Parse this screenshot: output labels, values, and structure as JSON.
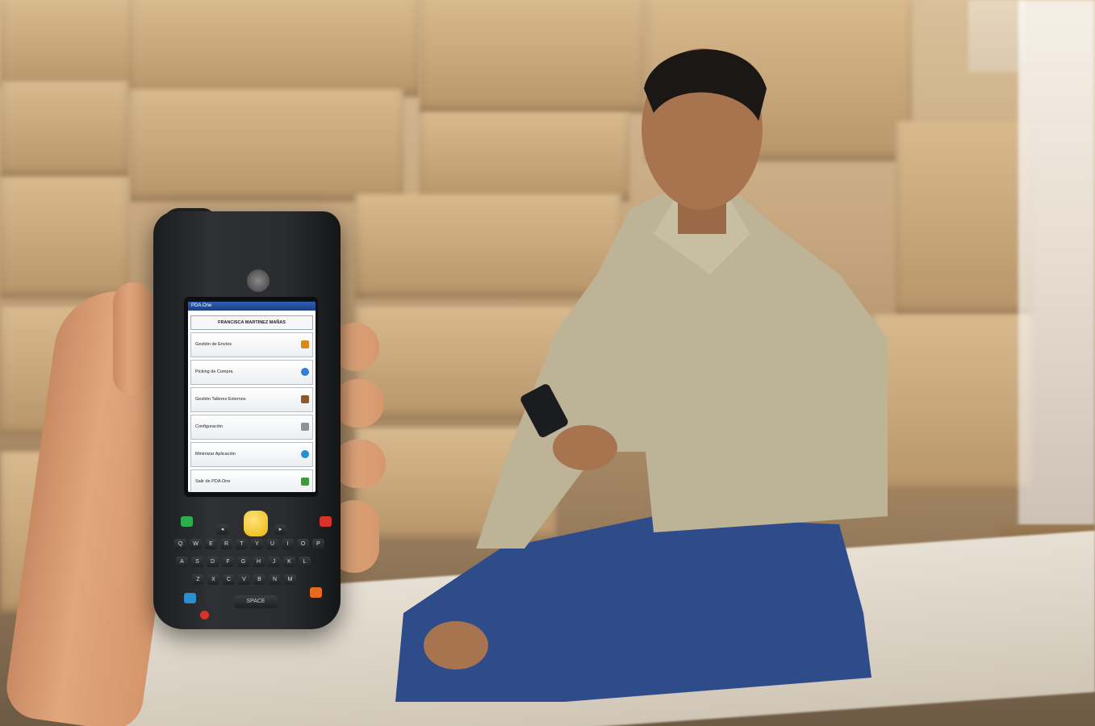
{
  "device": {
    "app_title": "PDA.One",
    "user_name": "FRANCISCA MARTINEZ MAÑAS",
    "menu": [
      {
        "label": "Gestión de Envíos",
        "icon": "truck-icon",
        "color": "#d98a1c"
      },
      {
        "label": "Picking de Compra",
        "icon": "info-icon",
        "color": "#2f7fd6"
      },
      {
        "label": "Gestión Talleres Externos",
        "icon": "workshop-icon",
        "color": "#8a5a2a"
      },
      {
        "label": "Configuración",
        "icon": "wrench-icon",
        "color": "#8f9398"
      },
      {
        "label": "Minimizar Aplicación",
        "icon": "globe-icon",
        "color": "#2a8fd0"
      },
      {
        "label": "Salir de PDA.One",
        "icon": "exit-icon",
        "color": "#3f9a3f"
      }
    ],
    "space_key": "SPACE",
    "keys_row1": [
      "Q",
      "W",
      "E",
      "R",
      "T",
      "Y",
      "U",
      "I",
      "O",
      "P"
    ],
    "keys_row2": [
      "A",
      "S",
      "D",
      "F",
      "G",
      "H",
      "J",
      "K",
      "L"
    ],
    "keys_row3": [
      "Z",
      "X",
      "C",
      "V",
      "B",
      "N",
      "M"
    ]
  },
  "colors": {
    "joystick": "#f2c417",
    "key_green": "#2fae4e",
    "key_red": "#d8332a",
    "key_blue": "#2a8fd0",
    "key_orange": "#e86a1e"
  }
}
